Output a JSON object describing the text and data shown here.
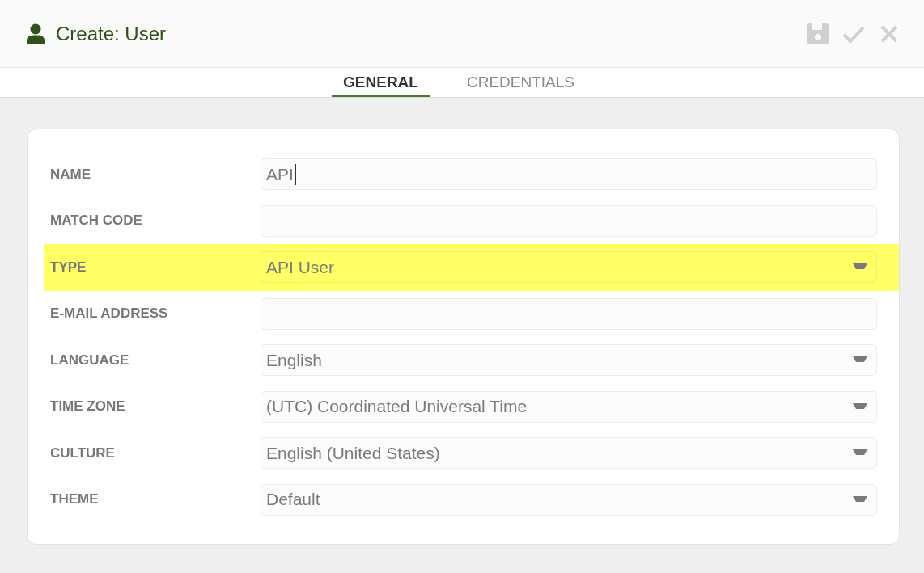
{
  "header": {
    "title": "Create: User"
  },
  "toolbar": [
    {
      "kind": "save",
      "disabled": true
    },
    {
      "kind": "confirm",
      "disabled": true
    },
    {
      "kind": "close",
      "disabled": true
    }
  ],
  "tabs": [
    {
      "label": "GENERAL",
      "selected": true
    },
    {
      "label": "CREDENTIALS",
      "selected": false
    }
  ],
  "fields": [
    {
      "label": "NAME",
      "kind": "text",
      "value": "API",
      "focused": true,
      "highlighted": false
    },
    {
      "label": "MATCH CODE",
      "kind": "text",
      "focused": false,
      "highlighted": false
    },
    {
      "label": "TYPE",
      "kind": "select",
      "value": "API User",
      "focused": false,
      "highlighted": true
    },
    {
      "label": "E-MAIL ADDRESS",
      "kind": "text",
      "focused": false,
      "highlighted": false
    },
    {
      "label": "LANGUAGE",
      "kind": "select",
      "value": "English",
      "focused": false,
      "highlighted": false
    },
    {
      "label": "TIME ZONE",
      "kind": "select",
      "value": "(UTC) Coordinated Universal Time",
      "focused": false,
      "highlighted": false
    },
    {
      "label": "CULTURE",
      "kind": "select",
      "value": "English (United States)",
      "focused": false,
      "highlighted": false
    },
    {
      "label": "THEME",
      "kind": "select",
      "value": "Default",
      "focused": false,
      "highlighted": false
    }
  ]
}
